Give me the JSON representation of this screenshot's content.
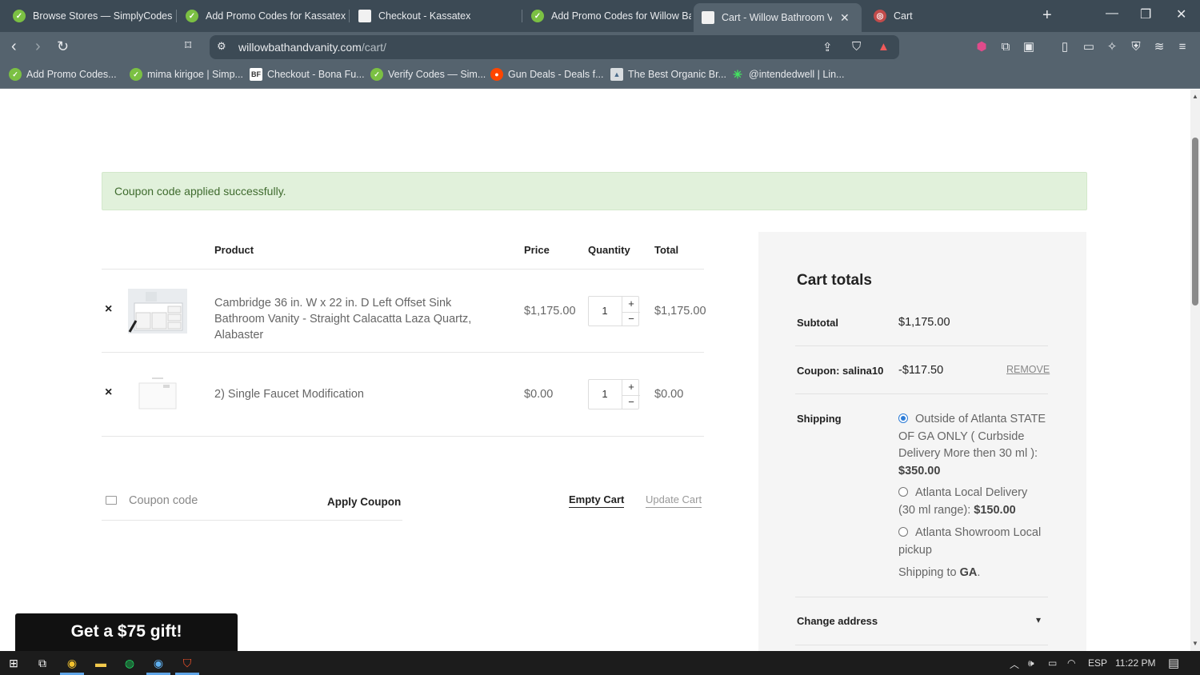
{
  "tabs": [
    {
      "title": "Browse Stores — SimplyCodes",
      "favicon": "simplycodes-icon"
    },
    {
      "title": "Add Promo Codes for Kassatex",
      "favicon": "simplycodes-icon"
    },
    {
      "title": "Checkout - Kassatex",
      "favicon": "page-icon"
    },
    {
      "title": "Add Promo Codes for Willow Ba",
      "favicon": "simplycodes-icon"
    },
    {
      "title": "Cart - Willow Bathroom Var",
      "favicon": "willow-icon",
      "active": true
    },
    {
      "title": "Cart",
      "favicon": "cart-icon"
    }
  ],
  "address": {
    "host": "willowbathandvanity.com",
    "path": "/cart/"
  },
  "bookmarks": [
    {
      "title": "Add Promo Codes...",
      "icon": "simplycodes-icon"
    },
    {
      "title": "mima kirigoe | Simp...",
      "icon": "simplycodes-icon"
    },
    {
      "title": "Checkout - Bona Fu...",
      "icon": "bf-icon"
    },
    {
      "title": "Verify Codes — Sim...",
      "icon": "simplycodes-icon"
    },
    {
      "title": "Gun Deals - Deals f...",
      "icon": "reddit-icon"
    },
    {
      "title": "The Best Organic Br...",
      "icon": "image-icon"
    },
    {
      "title": "@intendedwell | Lin...",
      "icon": "linktree-icon"
    }
  ],
  "notice": "Coupon code applied successfully.",
  "cart_table": {
    "headers": {
      "product": "Product",
      "price": "Price",
      "quantity": "Quantity",
      "total": "Total"
    },
    "rows": [
      {
        "name": "Cambridge 36 in. W x 22 in. D Left Offset Sink Bathroom Vanity - Straight Calacatta Laza Quartz, Alabaster",
        "price": "$1,175.00",
        "qty": "1",
        "total": "$1,175.00"
      },
      {
        "name": "2) Single Faucet Modification",
        "price": "$0.00",
        "qty": "1",
        "total": "$0.00"
      }
    ],
    "remove_symbol": "×"
  },
  "coupon": {
    "placeholder": "Coupon code",
    "apply_label": "Apply Coupon"
  },
  "actions": {
    "empty_cart": "Empty Cart",
    "update_cart": "Update Cart"
  },
  "totals": {
    "title": "Cart totals",
    "subtotal_label": "Subtotal",
    "subtotal": "$1,175.00",
    "coupon_label": "Coupon: salina10",
    "coupon_value": "-$117.50",
    "coupon_remove": "REMOVE",
    "shipping_label": "Shipping",
    "shipping_options": [
      {
        "text": "Outside of Atlanta STATE OF GA ONLY ( Curbside Delivery More then 30 ml ):",
        "price": "$350.00",
        "selected": true
      },
      {
        "text": "Atlanta Local Delivery (30 ml range):",
        "price": "$150.00",
        "selected": false
      },
      {
        "text": "Atlanta Showroom Local pickup",
        "price": "",
        "selected": false
      }
    ],
    "shipping_to_prefix": "Shipping to",
    "shipping_to_region": "GA",
    "change_address": "Change address"
  },
  "gift_banner": "Get a $75 gift!",
  "taskbar": {
    "language": "ESP",
    "time": "11:22 PM"
  },
  "colors": {
    "notice_bg": "#e1f1db",
    "notice_text": "#3f6b2e",
    "radio_accent": "#2e7dd7",
    "browser_chrome": "#3c4a55"
  }
}
